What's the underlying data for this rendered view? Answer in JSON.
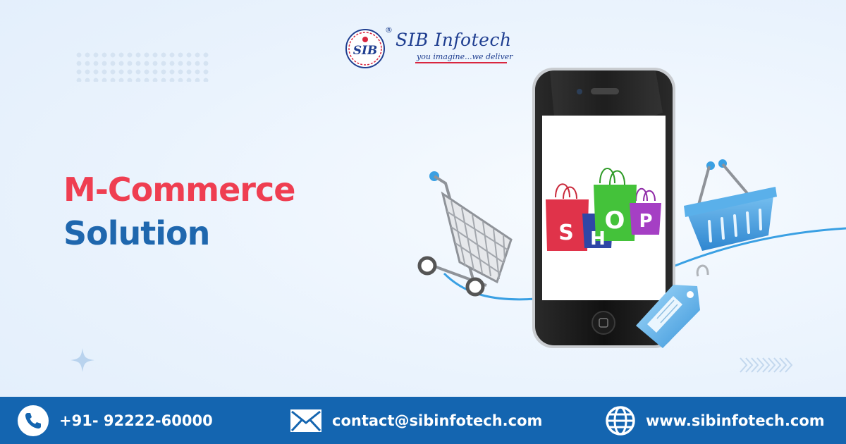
{
  "brand": {
    "badge_text": "SIB",
    "registered_mark": "®",
    "name": "SIB Infotech",
    "tagline": "you imagine...we deliver"
  },
  "headline": {
    "line1": "M-Commerce",
    "line2": "Solution"
  },
  "illustration": {
    "screen_text": "SHOP",
    "letters": [
      "S",
      "H",
      "O",
      "P"
    ]
  },
  "contact": {
    "phone": "+91- 92222-60000",
    "email": "contact@sibinfotech.com",
    "website": "www.sibinfotech.com"
  },
  "colors": {
    "headline_red": "#ef3e51",
    "headline_blue": "#1f67ae",
    "footer_bg": "#1465b0",
    "logo_blue": "#1f3e90"
  }
}
